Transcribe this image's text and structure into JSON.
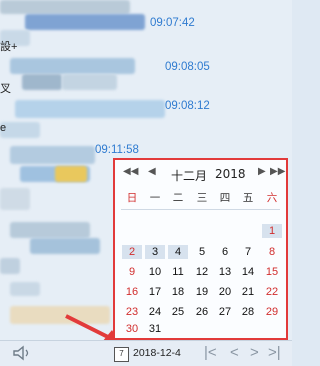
{
  "chat": {
    "timestamps": [
      "09:07:42",
      "09:08:05",
      "09:08:12",
      "09:11:58"
    ],
    "fragments": [
      "設+",
      "叉",
      "e"
    ]
  },
  "calendar": {
    "month_label": "十二月",
    "year_label": "2018",
    "weekdays": [
      "日",
      "一",
      "二",
      "三",
      "四",
      "五",
      "六"
    ],
    "nav": {
      "prev_year": "◀◀",
      "prev_month": "◀",
      "next_month": "▶",
      "next_year": "▶▶"
    },
    "weeks": [
      [
        "",
        "",
        "",
        "",
        "",
        "",
        "1"
      ],
      [
        "2",
        "3",
        "4",
        "5",
        "6",
        "7",
        "8"
      ],
      [
        "9",
        "10",
        "11",
        "12",
        "13",
        "14",
        "15"
      ],
      [
        "16",
        "17",
        "18",
        "19",
        "20",
        "21",
        "22"
      ],
      [
        "23",
        "24",
        "25",
        "26",
        "27",
        "28",
        "29"
      ],
      [
        "30",
        "31",
        "",
        "",
        "",
        "",
        ""
      ]
    ]
  },
  "statusbar": {
    "date_icon_text": "7",
    "date_value": "2018-12-4",
    "pager": [
      "|<",
      "<",
      ">",
      ">|"
    ]
  },
  "colors": {
    "accent": "#2f7bd0",
    "border_red": "#e23a3a",
    "weekend_red": "#d12d2d"
  }
}
